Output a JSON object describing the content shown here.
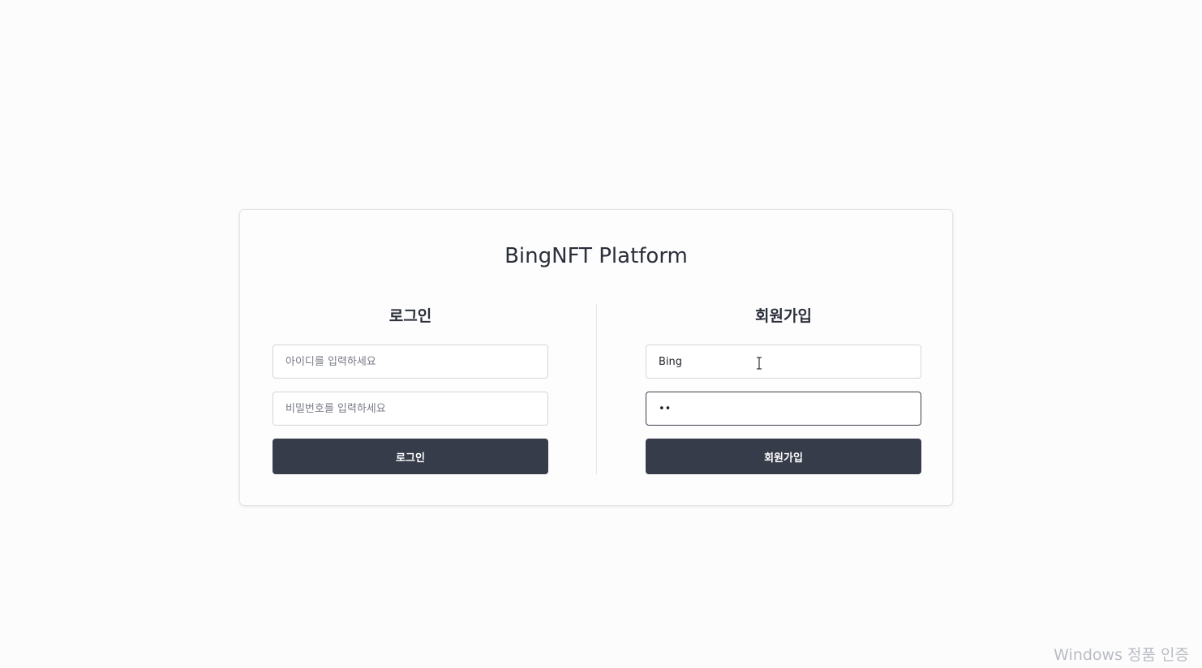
{
  "app": {
    "title": "BingNFT Platform"
  },
  "login": {
    "heading": "로그인",
    "id_placeholder": "아이디를 입력하세요",
    "id_value": "",
    "password_placeholder": "비밀번호를 입력하세요",
    "password_value": "",
    "button_label": "로그인"
  },
  "signup": {
    "heading": "회원가입",
    "id_value": "Bing",
    "password_value": "••",
    "button_label": "회원가입"
  },
  "colors": {
    "button_bg": "#363c4a",
    "title_text": "#2b2f3a"
  },
  "system": {
    "watermark": "Windows 정품 인증"
  }
}
